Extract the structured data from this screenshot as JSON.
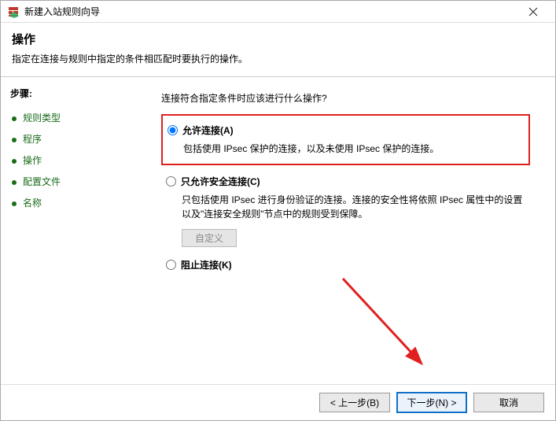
{
  "window": {
    "title": "新建入站规则向导"
  },
  "header": {
    "title": "操作",
    "subtitle": "指定在连接与规则中指定的条件相匹配时要执行的操作。"
  },
  "sidebar": {
    "steps_label": "步骤:",
    "items": [
      {
        "label": "规则类型"
      },
      {
        "label": "程序"
      },
      {
        "label": "操作"
      },
      {
        "label": "配置文件"
      },
      {
        "label": "名称"
      }
    ]
  },
  "main": {
    "question": "连接符合指定条件时应该进行什么操作?",
    "options": [
      {
        "label": "允许连接(A)",
        "desc": "包括使用 IPsec 保护的连接，以及未使用 IPsec 保护的连接。",
        "selected": true,
        "highlighted": true
      },
      {
        "label": "只允许安全连接(C)",
        "desc": "只包括使用 IPsec 进行身份验证的连接。连接的安全性将依照 IPsec 属性中的设置以及\"连接安全规则\"节点中的规则受到保障。",
        "custom_button": "自定义"
      },
      {
        "label": "阻止连接(K)"
      }
    ]
  },
  "footer": {
    "back": "< 上一步(B)",
    "next": "下一步(N) >",
    "cancel": "取消"
  }
}
